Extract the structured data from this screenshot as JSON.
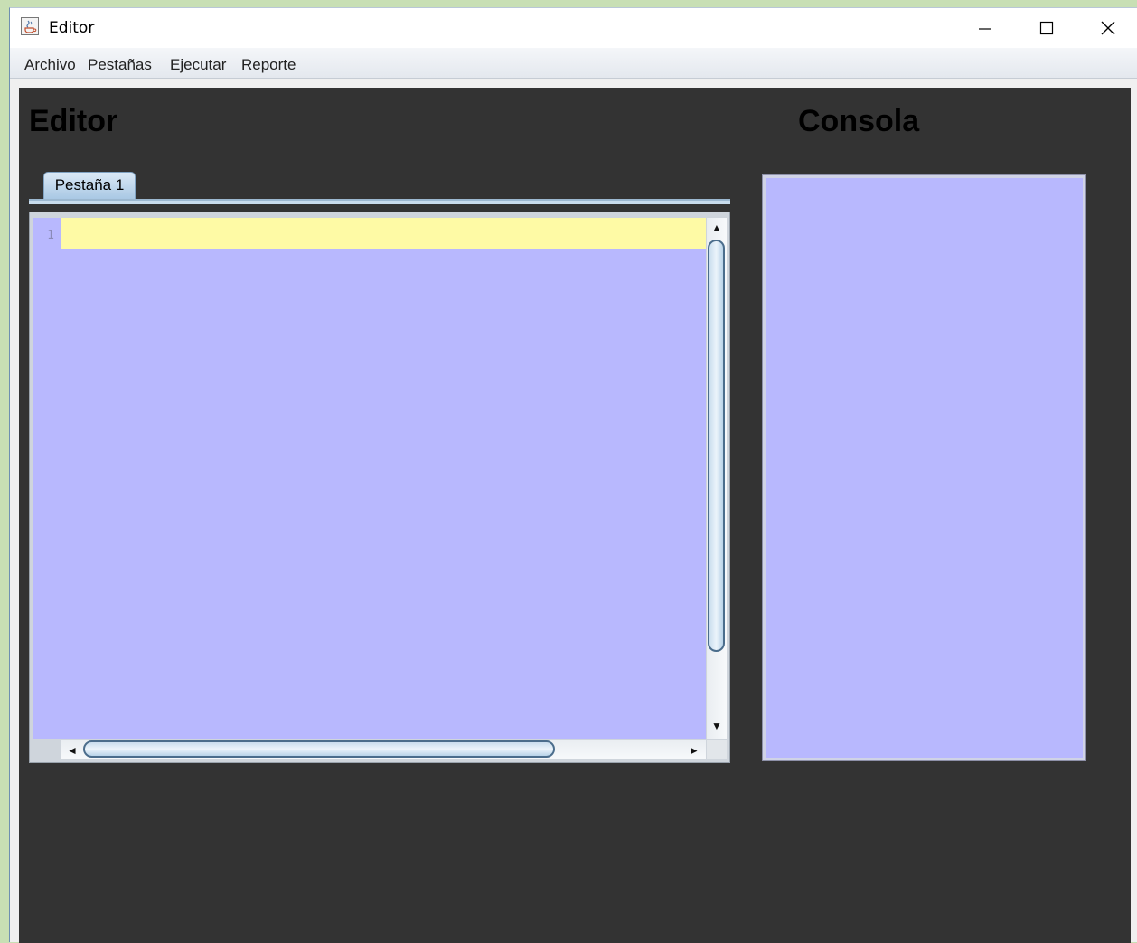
{
  "window": {
    "title": "Editor",
    "icon": "java-cup-icon"
  },
  "menubar": {
    "items": [
      "Archivo",
      "Pestañas",
      "Ejecutar",
      "Reporte"
    ]
  },
  "editor": {
    "heading": "Editor",
    "tabs": [
      {
        "label": "Pestaña 1"
      }
    ],
    "line_numbers": [
      "1"
    ],
    "content": ""
  },
  "console": {
    "heading": "Consola",
    "content": ""
  },
  "colors": {
    "panel_background": "#333333",
    "text_area": "#b8b8fe",
    "current_line": "#fefaa5"
  }
}
